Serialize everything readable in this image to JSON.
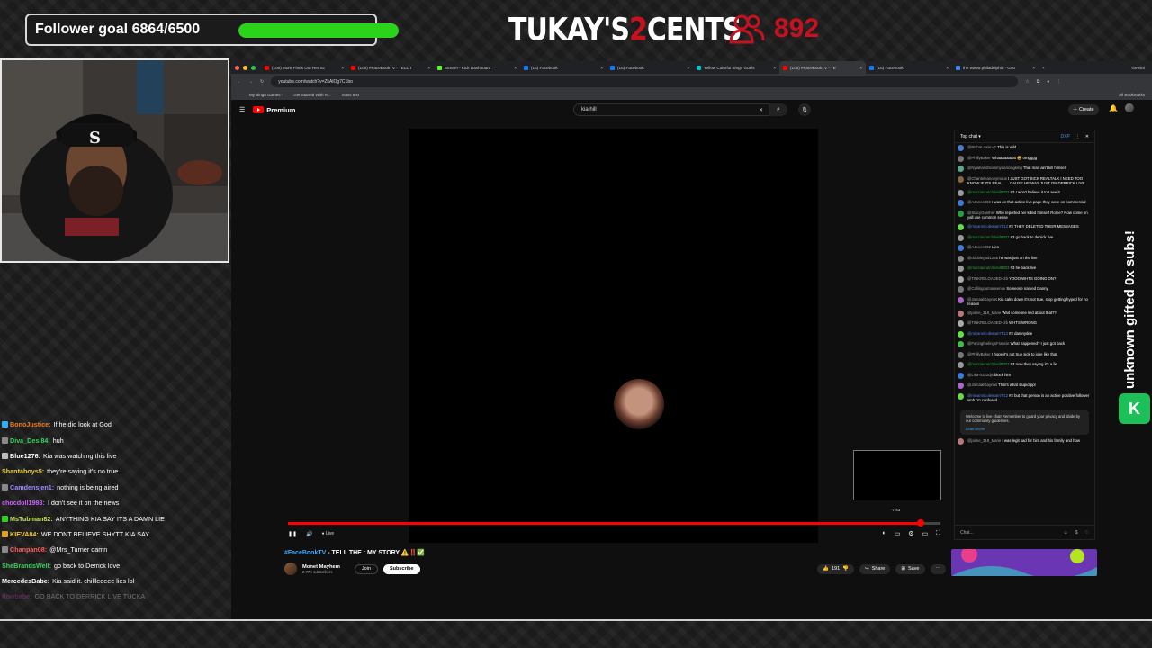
{
  "overlay": {
    "follower_goal_text": "Follower goal 6864/6500",
    "follower_goal_progress": 1.0,
    "brand_text_a": "TUKAY'S",
    "brand_text_b": "2",
    "brand_text_c": "CENTS",
    "viewer_count": "892",
    "gifted_text": "unknown gifted 0x subs!"
  },
  "stream_chat": [
    {
      "user": "BonoJustice:",
      "user_color": "#f07d22",
      "msg": "If he did look at God",
      "badge": "#2bb0ff"
    },
    {
      "user": "Diva_Desi84:",
      "user_color": "#3ad15b",
      "msg": "huh",
      "badge": "#888"
    },
    {
      "user": "Blue1276:",
      "user_color": "#ffffff",
      "msg": "Kia was watching this live",
      "badge": "#bbb"
    },
    {
      "user": "Shantaboys5:",
      "user_color": "#e8d04a",
      "msg": "they're saying it's no true",
      "badge": ""
    },
    {
      "user": "Camdensjen1:",
      "user_color": "#9b8cff",
      "msg": "nothing is being aired",
      "badge": "#888"
    },
    {
      "user": "chocdoll1993:",
      "user_color": "#d05cff",
      "msg": "I don't see it on the news",
      "badge": ""
    },
    {
      "user": "MsTubman82:",
      "user_color": "#c6e05b",
      "msg": "ANYTHING KIA SAY ITS A DAMN LIE",
      "badge": "#2bd41b"
    },
    {
      "user": "KIEVA84:",
      "user_color": "#f0c83a",
      "msg": "WE DONT BELIEVE SHYTT KIA SAY",
      "badge": "#e0a020"
    },
    {
      "user": "Chanpan08:",
      "user_color": "#ff5e5e",
      "msg": "@Mrs_Turner damn",
      "badge": "#888"
    },
    {
      "user": "SheBrandsWell:",
      "user_color": "#3ad15b",
      "msg": "go back to Derrick love",
      "badge": ""
    },
    {
      "user": "MercedesBabe:",
      "user_color": "#ffffff",
      "msg": "Kia said it. chillleeeee lies lol",
      "badge": ""
    },
    {
      "user": "flowbabe:",
      "user_color": "#c040c0",
      "msg": "GO BACK TO DERRICK LIVE TUCKA",
      "badge": "",
      "faded": true
    }
  ],
  "browser": {
    "tabs": [
      {
        "title": "(108) More Finds Out Her Sc",
        "color": "#ff0000"
      },
      {
        "title": "(108) #FaceBookTV - TELL T",
        "color": "#ff0000"
      },
      {
        "title": "Stream - Kick Dashboard",
        "color": "#53fc18"
      },
      {
        "title": "(16) Facebook",
        "color": "#1877f2"
      },
      {
        "title": "(16) Facebook",
        "color": "#1877f2"
      },
      {
        "title": "Yellow Colorful Bingo Goals",
        "color": "#00c4cc"
      },
      {
        "title": "(108) #FaceBookTV - TE",
        "color": "#ff0000",
        "active": true
      },
      {
        "title": "(16) Facebook",
        "color": "#1877f2"
      },
      {
        "title": "the wawa philadelphia - Goo",
        "color": "#4285f4"
      }
    ],
    "gemini_label": "Gemini",
    "address": "youtube.com/watch?v=ZkAlOg7C1bo",
    "bookmarks": [
      "My Bingo Games -",
      "Get Started With R...",
      "mass text"
    ],
    "all_bookmarks": "All Bookmarks"
  },
  "youtube": {
    "logo_text": "Premium",
    "search_value": "kia hill",
    "create_label": "Create",
    "notif_count": "9+",
    "live_label": "Live",
    "time_label": "-7:43",
    "progress": 0.97,
    "title_tag": "#FaceBookTV",
    "title_rest": " - TELL THE : MY STORY ⚠️‼️✅",
    "channel_name": "Monet Mayhem",
    "channel_subs": "2.77K subscribers",
    "join_label": "Join",
    "subscribe_label": "Subscribe",
    "like_count": "191",
    "share_label": "Share",
    "save_label": "Save"
  },
  "live_chat": {
    "header": "Top chat",
    "badge_label": "DXP",
    "input_placeholder": "Chat...",
    "messages": [
      {
        "user": "@BishaLewis-v2",
        "msg": "This is wild",
        "type": "normal",
        "av": "#4a7bd0"
      },
      {
        "user": "@PhillyBaker",
        "msg": "Whaaaaaaaat 😩 omgggg",
        "type": "normal",
        "av": "#777"
      },
      {
        "user": "@Nylahandmommydancingking",
        "msg": "That man ain't kill himself",
        "type": "normal",
        "av": "#5a8"
      },
      {
        "user": "@Chanteleanonymous",
        "msg": "I JUST GOT SICK REALTALK I NEED TOO KNOW IF ITS REAL...... CAUSE HE WAS JUST ON DERRICK LIVE",
        "type": "normal",
        "av": "#864"
      },
      {
        "user": "@marciacrutchfield8303",
        "msg": "#3  I won't believe it to I see it",
        "type": "member",
        "av": "#999"
      },
      {
        "user": "@AJones002",
        "msg": "I was on that action live page they were on commercial",
        "type": "normal",
        "av": "#3a7bd5"
      },
      {
        "user": "@StacyGunther",
        "msg": "Who reported her killed himself Rome? Now come on yall use common sense",
        "type": "normal",
        "av": "#2a9d4a"
      },
      {
        "user": "@miyannicoleman7812",
        "msg": "#2  THEY DELETED THEIR MESSAGES",
        "type": "blue",
        "av": "#6d4"
      },
      {
        "user": "@marciacrutchfield8303",
        "msg": "#3  go back to derrick live",
        "type": "member",
        "av": "#999"
      },
      {
        "user": "@AJones002",
        "msg": "Lies",
        "type": "normal",
        "av": "#3a7bd5"
      },
      {
        "user": "@dribblegod1285",
        "msg": "he was just on the live",
        "type": "normal",
        "av": "#888"
      },
      {
        "user": "@marciacrutchfield8303",
        "msg": "#3  he back live",
        "type": "member",
        "av": "#999"
      },
      {
        "user": "@TINKRELOADED-i2b",
        "msg": "YOOO WHTS GOING ON?",
        "type": "normal",
        "av": "#aaa"
      },
      {
        "user": "@Callingoutnonsense",
        "msg": "Someone named Danny",
        "type": "normal",
        "av": "#777"
      },
      {
        "user": "@JamaalGaynus",
        "msg": "Kia calm down it's not true, stop getting hyped for no reason",
        "type": "normal",
        "av": "#a6c"
      },
      {
        "user": "@jaime_318_Marie",
        "msg": "Wait someone lied about that??",
        "type": "normal",
        "av": "#b77"
      },
      {
        "user": "@TINKRELOADED-i2b",
        "msg": "WHTS WRONG",
        "type": "normal",
        "av": "#aaa"
      },
      {
        "user": "@miyannicoleman7812",
        "msg": "#2  damnydee",
        "type": "blue",
        "av": "#6d4"
      },
      {
        "user": "@FacingfeelingsFrancie",
        "msg": "What happened? I just got back",
        "type": "normal",
        "av": "#4b4"
      },
      {
        "user": "@PhillyBaker",
        "msg": "I hope it's not true sick to joke like that",
        "type": "normal",
        "av": "#777"
      },
      {
        "user": "@marciacrutchfield8303",
        "msg": "#3  now they saying it's a lie",
        "type": "member",
        "av": "#999"
      },
      {
        "user": "@Lisa-0322djs",
        "msg": "block him",
        "type": "normal",
        "av": "#3a7bd5"
      },
      {
        "user": "@JamaalGaynus",
        "msg": "That's what stupid ppl",
        "type": "normal",
        "av": "#a6c"
      },
      {
        "user": "@miyannicoleman7812",
        "msg": "#2  but that person is an active positive follower smh i'm confused",
        "type": "blue",
        "av": "#6d4"
      }
    ],
    "notice": "Welcome to live chat! Remember to guard your privacy and abide by our community guidelines.",
    "notice_link": "Learn more",
    "last_msg_user": "@jaime_318_Marie",
    "last_msg": "I was legit sad for him and his family and how"
  }
}
